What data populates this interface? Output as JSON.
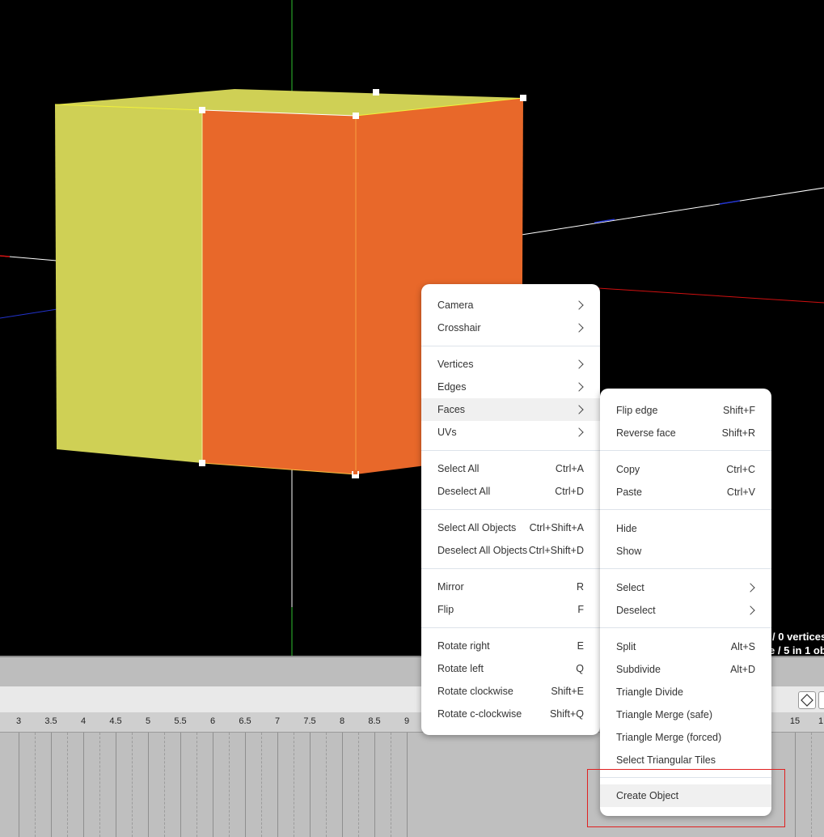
{
  "status": {
    "vertices_text": "/ 0 vertices",
    "objects_text": "e / 5 in 1 ob"
  },
  "ruler": {
    "ticks": [
      "3",
      "3.5",
      "4",
      "4.5",
      "5",
      "5.5",
      "6",
      "6.5",
      "7",
      "7.5",
      "8",
      "8.5",
      "9",
      "15",
      "1"
    ]
  },
  "context_menu": {
    "camera": "Camera",
    "crosshair": "Crosshair",
    "vertices": "Vertices",
    "edges": "Edges",
    "faces": "Faces",
    "uvs": "UVs",
    "select_all": {
      "label": "Select All",
      "shortcut": "Ctrl+A"
    },
    "deselect_all": {
      "label": "Deselect All",
      "shortcut": "Ctrl+D"
    },
    "select_all_objects": {
      "label": "Select All Objects",
      "shortcut": "Ctrl+Shift+A"
    },
    "deselect_all_objects": {
      "label": "Deselect All Objects",
      "shortcut": "Ctrl+Shift+D"
    },
    "mirror": {
      "label": "Mirror",
      "shortcut": "R"
    },
    "flip": {
      "label": "Flip",
      "shortcut": "F"
    },
    "rotate_right": {
      "label": "Rotate right",
      "shortcut": "E"
    },
    "rotate_left": {
      "label": "Rotate left",
      "shortcut": "Q"
    },
    "rotate_clockwise": {
      "label": "Rotate clockwise",
      "shortcut": "Shift+E"
    },
    "rotate_c_clockwise": {
      "label": "Rotate c-clockwise",
      "shortcut": "Shift+Q"
    }
  },
  "faces_submenu": {
    "flip_edge": {
      "label": "Flip edge",
      "shortcut": "Shift+F"
    },
    "reverse_face": {
      "label": "Reverse face",
      "shortcut": "Shift+R"
    },
    "copy": {
      "label": "Copy",
      "shortcut": "Ctrl+C"
    },
    "paste": {
      "label": "Paste",
      "shortcut": "Ctrl+V"
    },
    "hide": "Hide",
    "show": "Show",
    "select": "Select",
    "deselect": "Deselect",
    "split": {
      "label": "Split",
      "shortcut": "Alt+S"
    },
    "subdivide": {
      "label": "Subdivide",
      "shortcut": "Alt+D"
    },
    "triangle_divide": "Triangle Divide",
    "triangle_merge_safe": "Triangle Merge (safe)",
    "triangle_merge_forced": "Triangle Merge (forced)",
    "select_triangular_tiles": "Select Triangular Tiles",
    "create_object": "Create Object"
  },
  "colors": {
    "face_yellow": "#cfd055",
    "face_orange": "#e8682a",
    "highlight_box": "#e02020"
  }
}
